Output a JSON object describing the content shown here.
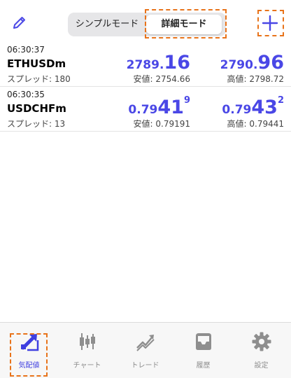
{
  "header": {
    "segments": [
      "シンプルモード",
      "詳細モード"
    ],
    "selected_segment": "詳細モード",
    "edit_icon": "pencil-icon",
    "add_icon": "plus-icon"
  },
  "quotes": [
    {
      "time": "06:30:37",
      "symbol": "ETHUSDm",
      "spread_label": "スプレッド:",
      "spread": "180",
      "bid": {
        "prefix": "2789.",
        "big": "16",
        "sup": ""
      },
      "ask": {
        "prefix": "2790.",
        "big": "96",
        "sup": ""
      },
      "low_label": "安値:",
      "low": "2754.66",
      "high_label": "高値:",
      "high": "2798.72"
    },
    {
      "time": "06:30:35",
      "symbol": "USDCHFm",
      "spread_label": "スプレッド:",
      "spread": "13",
      "bid": {
        "prefix": "0.79",
        "big": "41",
        "sup": "9"
      },
      "ask": {
        "prefix": "0.79",
        "big": "43",
        "sup": "2"
      },
      "low_label": "安値:",
      "low": "0.79191",
      "high_label": "高値:",
      "high": "0.79441"
    }
  ],
  "tabs": [
    {
      "label": "気配値",
      "icon": "quotes-icon",
      "active": true
    },
    {
      "label": "チャート",
      "icon": "candlestick-icon",
      "active": false
    },
    {
      "label": "トレード",
      "icon": "trade-icon",
      "active": false
    },
    {
      "label": "履歴",
      "icon": "history-icon",
      "active": false
    },
    {
      "label": "設定",
      "icon": "gear-icon",
      "active": false
    }
  ],
  "colors": {
    "accent": "#4a47e6",
    "highlight": "#e8731a",
    "inactive": "#8e8e8e"
  }
}
